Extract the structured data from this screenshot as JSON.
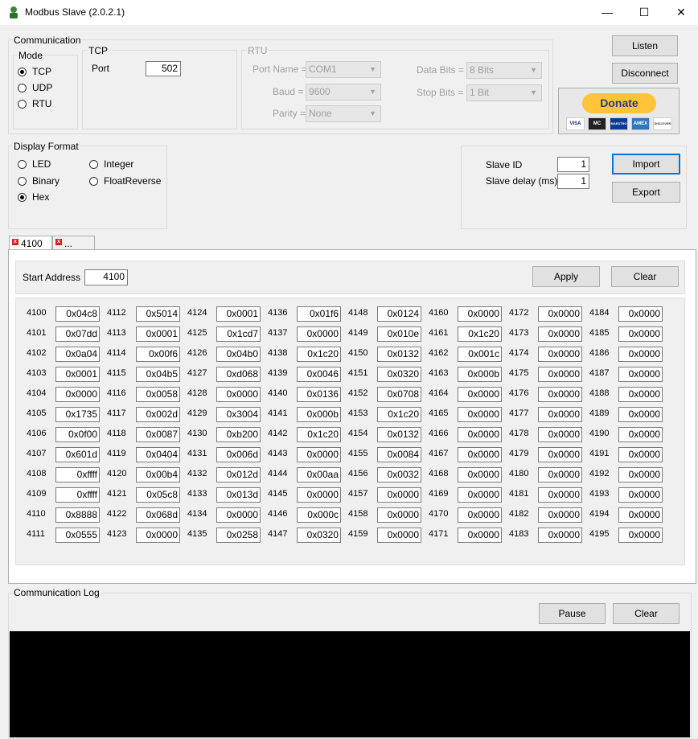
{
  "window": {
    "title": "Modbus Slave (2.0.2.1)",
    "minimize": "—",
    "maximize": "☐",
    "close": "✕"
  },
  "communication": {
    "group_label": "Communication",
    "mode": {
      "label": "Mode",
      "options": [
        "TCP",
        "UDP",
        "RTU"
      ],
      "selected": "TCP"
    },
    "tcp": {
      "label": "TCP",
      "port_label": "Port",
      "port_value": "502"
    },
    "rtu": {
      "label": "RTU",
      "port_name_label": "Port Name =",
      "port_name_value": "COM1",
      "baud_label": "Baud =",
      "baud_value": "9600",
      "parity_label": "Parity =",
      "parity_value": "None",
      "data_bits_label": "Data Bits =",
      "data_bits_value": "8 Bits",
      "stop_bits_label": "Stop Bits =",
      "stop_bits_value": "1 Bit"
    }
  },
  "buttons": {
    "listen": "Listen",
    "disconnect": "Disconnect",
    "import": "Import",
    "export": "Export",
    "apply": "Apply",
    "clear": "Clear",
    "pause": "Pause",
    "log_clear": "Clear"
  },
  "donate": {
    "label": "Donate",
    "cards": [
      "VISA",
      "MC",
      "MAESTRO",
      "AMEX",
      "DISCOVER"
    ]
  },
  "display_format": {
    "label": "Display Format",
    "options": [
      "LED",
      "Binary",
      "Hex",
      "Integer",
      "FloatReverse"
    ],
    "selected": "Hex"
  },
  "slave": {
    "id_label": "Slave ID",
    "id_value": "1",
    "delay_label": "Slave delay (ms)",
    "delay_value": "1"
  },
  "tabs": [
    {
      "label": "4100"
    },
    {
      "label": "..."
    }
  ],
  "registers": {
    "start_address_label": "Start Address",
    "start_address_value": "4100",
    "columns": [
      {
        "addrs": [
          "4100",
          "4101",
          "4102",
          "4103",
          "4104",
          "4105",
          "4106",
          "4107",
          "4108",
          "4109",
          "4110",
          "4111"
        ],
        "values": [
          "0x04c8",
          "0x07dd",
          "0x0a04",
          "0x0001",
          "0x0000",
          "0x1735",
          "0x0f00",
          "0x601d",
          "0xffff",
          "0xffff",
          "0x8888",
          "0x0555"
        ]
      },
      {
        "addrs": [
          "4112",
          "4113",
          "4114",
          "4115",
          "4116",
          "4117",
          "4118",
          "4119",
          "4120",
          "4121",
          "4122",
          "4123"
        ],
        "values": [
          "0x5014",
          "0x0001",
          "0x00f6",
          "0x04b5",
          "0x0058",
          "0x002d",
          "0x0087",
          "0x0404",
          "0x00b4",
          "0x05c8",
          "0x068d",
          "0x0000"
        ]
      },
      {
        "addrs": [
          "4124",
          "4125",
          "4126",
          "4127",
          "4128",
          "4129",
          "4130",
          "4131",
          "4132",
          "4133",
          "4134",
          "4135"
        ],
        "values": [
          "0x0001",
          "0x1cd7",
          "0x04b0",
          "0xd068",
          "0x0000",
          "0x3004",
          "0xb200",
          "0x006d",
          "0x012d",
          "0x013d",
          "0x0000",
          "0x0258"
        ]
      },
      {
        "addrs": [
          "4136",
          "4137",
          "4138",
          "4139",
          "4140",
          "4141",
          "4142",
          "4143",
          "4144",
          "4145",
          "4146",
          "4147"
        ],
        "values": [
          "0x01f6",
          "0x0000",
          "0x1c20",
          "0x0046",
          "0x0136",
          "0x000b",
          "0x1c20",
          "0x0000",
          "0x00aa",
          "0x0000",
          "0x000c",
          "0x0320"
        ]
      },
      {
        "addrs": [
          "4148",
          "4149",
          "4150",
          "4151",
          "4152",
          "4153",
          "4154",
          "4155",
          "4156",
          "4157",
          "4158",
          "4159"
        ],
        "values": [
          "0x0124",
          "0x010e",
          "0x0132",
          "0x0320",
          "0x0708",
          "0x1c20",
          "0x0132",
          "0x0084",
          "0x0032",
          "0x0000",
          "0x0000",
          "0x0000"
        ]
      },
      {
        "addrs": [
          "4160",
          "4161",
          "4162",
          "4163",
          "4164",
          "4165",
          "4166",
          "4167",
          "4168",
          "4169",
          "4170",
          "4171"
        ],
        "values": [
          "0x0000",
          "0x1c20",
          "0x001c",
          "0x000b",
          "0x0000",
          "0x0000",
          "0x0000",
          "0x0000",
          "0x0000",
          "0x0000",
          "0x0000",
          "0x0000"
        ]
      },
      {
        "addrs": [
          "4172",
          "4173",
          "4174",
          "4175",
          "4176",
          "4177",
          "4178",
          "4179",
          "4180",
          "4181",
          "4182",
          "4183"
        ],
        "values": [
          "0x0000",
          "0x0000",
          "0x0000",
          "0x0000",
          "0x0000",
          "0x0000",
          "0x0000",
          "0x0000",
          "0x0000",
          "0x0000",
          "0x0000",
          "0x0000"
        ]
      },
      {
        "addrs": [
          "4184",
          "4185",
          "4186",
          "4187",
          "4188",
          "4189",
          "4190",
          "4191",
          "4192",
          "4193",
          "4194",
          "4195"
        ],
        "values": [
          "0x0000",
          "0x0000",
          "0x0000",
          "0x0000",
          "0x0000",
          "0x0000",
          "0x0000",
          "0x0000",
          "0x0000",
          "0x0000",
          "0x0000",
          "0x0000"
        ]
      }
    ]
  },
  "log": {
    "label": "Communication Log"
  }
}
